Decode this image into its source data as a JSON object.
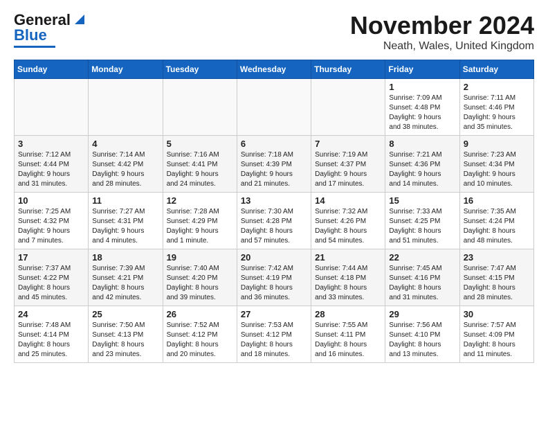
{
  "header": {
    "logo_line1": "General",
    "logo_line2": "Blue",
    "month": "November 2024",
    "location": "Neath, Wales, United Kingdom"
  },
  "days_of_week": [
    "Sunday",
    "Monday",
    "Tuesday",
    "Wednesday",
    "Thursday",
    "Friday",
    "Saturday"
  ],
  "weeks": [
    [
      {
        "num": "",
        "info": ""
      },
      {
        "num": "",
        "info": ""
      },
      {
        "num": "",
        "info": ""
      },
      {
        "num": "",
        "info": ""
      },
      {
        "num": "",
        "info": ""
      },
      {
        "num": "1",
        "info": "Sunrise: 7:09 AM\nSunset: 4:48 PM\nDaylight: 9 hours\nand 38 minutes."
      },
      {
        "num": "2",
        "info": "Sunrise: 7:11 AM\nSunset: 4:46 PM\nDaylight: 9 hours\nand 35 minutes."
      }
    ],
    [
      {
        "num": "3",
        "info": "Sunrise: 7:12 AM\nSunset: 4:44 PM\nDaylight: 9 hours\nand 31 minutes."
      },
      {
        "num": "4",
        "info": "Sunrise: 7:14 AM\nSunset: 4:42 PM\nDaylight: 9 hours\nand 28 minutes."
      },
      {
        "num": "5",
        "info": "Sunrise: 7:16 AM\nSunset: 4:41 PM\nDaylight: 9 hours\nand 24 minutes."
      },
      {
        "num": "6",
        "info": "Sunrise: 7:18 AM\nSunset: 4:39 PM\nDaylight: 9 hours\nand 21 minutes."
      },
      {
        "num": "7",
        "info": "Sunrise: 7:19 AM\nSunset: 4:37 PM\nDaylight: 9 hours\nand 17 minutes."
      },
      {
        "num": "8",
        "info": "Sunrise: 7:21 AM\nSunset: 4:36 PM\nDaylight: 9 hours\nand 14 minutes."
      },
      {
        "num": "9",
        "info": "Sunrise: 7:23 AM\nSunset: 4:34 PM\nDaylight: 9 hours\nand 10 minutes."
      }
    ],
    [
      {
        "num": "10",
        "info": "Sunrise: 7:25 AM\nSunset: 4:32 PM\nDaylight: 9 hours\nand 7 minutes."
      },
      {
        "num": "11",
        "info": "Sunrise: 7:27 AM\nSunset: 4:31 PM\nDaylight: 9 hours\nand 4 minutes."
      },
      {
        "num": "12",
        "info": "Sunrise: 7:28 AM\nSunset: 4:29 PM\nDaylight: 9 hours\nand 1 minute."
      },
      {
        "num": "13",
        "info": "Sunrise: 7:30 AM\nSunset: 4:28 PM\nDaylight: 8 hours\nand 57 minutes."
      },
      {
        "num": "14",
        "info": "Sunrise: 7:32 AM\nSunset: 4:26 PM\nDaylight: 8 hours\nand 54 minutes."
      },
      {
        "num": "15",
        "info": "Sunrise: 7:33 AM\nSunset: 4:25 PM\nDaylight: 8 hours\nand 51 minutes."
      },
      {
        "num": "16",
        "info": "Sunrise: 7:35 AM\nSunset: 4:24 PM\nDaylight: 8 hours\nand 48 minutes."
      }
    ],
    [
      {
        "num": "17",
        "info": "Sunrise: 7:37 AM\nSunset: 4:22 PM\nDaylight: 8 hours\nand 45 minutes."
      },
      {
        "num": "18",
        "info": "Sunrise: 7:39 AM\nSunset: 4:21 PM\nDaylight: 8 hours\nand 42 minutes."
      },
      {
        "num": "19",
        "info": "Sunrise: 7:40 AM\nSunset: 4:20 PM\nDaylight: 8 hours\nand 39 minutes."
      },
      {
        "num": "20",
        "info": "Sunrise: 7:42 AM\nSunset: 4:19 PM\nDaylight: 8 hours\nand 36 minutes."
      },
      {
        "num": "21",
        "info": "Sunrise: 7:44 AM\nSunset: 4:18 PM\nDaylight: 8 hours\nand 33 minutes."
      },
      {
        "num": "22",
        "info": "Sunrise: 7:45 AM\nSunset: 4:16 PM\nDaylight: 8 hours\nand 31 minutes."
      },
      {
        "num": "23",
        "info": "Sunrise: 7:47 AM\nSunset: 4:15 PM\nDaylight: 8 hours\nand 28 minutes."
      }
    ],
    [
      {
        "num": "24",
        "info": "Sunrise: 7:48 AM\nSunset: 4:14 PM\nDaylight: 8 hours\nand 25 minutes."
      },
      {
        "num": "25",
        "info": "Sunrise: 7:50 AM\nSunset: 4:13 PM\nDaylight: 8 hours\nand 23 minutes."
      },
      {
        "num": "26",
        "info": "Sunrise: 7:52 AM\nSunset: 4:12 PM\nDaylight: 8 hours\nand 20 minutes."
      },
      {
        "num": "27",
        "info": "Sunrise: 7:53 AM\nSunset: 4:12 PM\nDaylight: 8 hours\nand 18 minutes."
      },
      {
        "num": "28",
        "info": "Sunrise: 7:55 AM\nSunset: 4:11 PM\nDaylight: 8 hours\nand 16 minutes."
      },
      {
        "num": "29",
        "info": "Sunrise: 7:56 AM\nSunset: 4:10 PM\nDaylight: 8 hours\nand 13 minutes."
      },
      {
        "num": "30",
        "info": "Sunrise: 7:57 AM\nSunset: 4:09 PM\nDaylight: 8 hours\nand 11 minutes."
      }
    ]
  ]
}
